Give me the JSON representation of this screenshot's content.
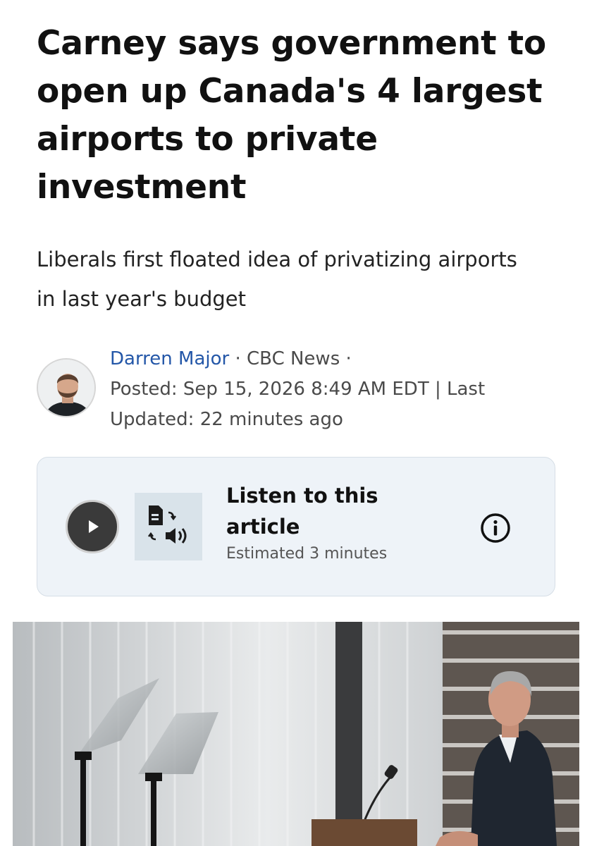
{
  "article": {
    "headline": "Carney says government to open up Canada's 4 largest airports to private investment",
    "dek": "Liberals first floated idea of privatizing airports in last year's budget"
  },
  "byline": {
    "author": "Darren Major",
    "separator": " · ",
    "outlet": "CBC News",
    "trailing_separator": " ·",
    "posted": "Posted: Sep 15, 2026 8:49 AM EDT | Last Updated: 22 minutes ago"
  },
  "listen": {
    "title": "Listen to this article",
    "subtitle": "Estimated 3 minutes",
    "play_icon": "play-icon",
    "tts_icon": "text-to-speech-icon",
    "info_icon": "info-icon"
  },
  "colors": {
    "author_link": "#2457a8",
    "card_background": "#eef3f8",
    "play_button": "#3a3a3a"
  }
}
